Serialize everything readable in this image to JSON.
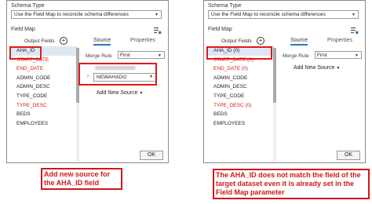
{
  "left": {
    "schema_type_label": "Schema Type",
    "schema_type_value": "Use the Field Map to reconcile schema differences",
    "field_map_label": "Field Map",
    "output_fields_label": "Output Fields",
    "source_tab": "Source",
    "properties_tab": "Properties",
    "fields": [
      {
        "name": "AHA_ID",
        "color": "#222222"
      },
      {
        "name": "START_DATE",
        "color": "#d41c1c"
      },
      {
        "name": "END_DATE",
        "color": "#d41c1c"
      },
      {
        "name": "ADMIN_CODE",
        "color": "#222222"
      },
      {
        "name": "ADMIN_DESC",
        "color": "#222222"
      },
      {
        "name": "TYPE_CODE",
        "color": "#222222"
      },
      {
        "name": "TYPE_DESC",
        "color": "#d41c1c"
      },
      {
        "name": "BEDS",
        "color": "#222222"
      },
      {
        "name": "EMPLOYEES",
        "color": "#222222"
      }
    ],
    "merge_rule_label": "Merge Rule",
    "merge_rule_value": "First",
    "source_value": "NEWAHADI2",
    "add_new_source": "Add New Source",
    "ok_label": "OK",
    "caption": "Add new source for the AHA_ID field"
  },
  "right": {
    "schema_type_label": "Schema Type",
    "schema_type_value": "Use the Field Map to reconcile schema differences",
    "field_map_label": "Field Map",
    "output_fields_label": "Output Fields",
    "source_tab": "Source",
    "properties_tab": "Properties",
    "fields": [
      {
        "name": "AHA_ID (0)",
        "color": "#222222"
      },
      {
        "name": "START_DATE (0)",
        "color": "#d41c1c"
      },
      {
        "name": "END_DATE (0)",
        "color": "#d41c1c"
      },
      {
        "name": "ADMIN_CODE",
        "color": "#222222"
      },
      {
        "name": "ADMIN_DESC",
        "color": "#222222"
      },
      {
        "name": "TYPE_CODE",
        "color": "#222222"
      },
      {
        "name": "TYPE_DESC (0)",
        "color": "#d41c1c"
      },
      {
        "name": "BEDS",
        "color": "#222222"
      },
      {
        "name": "EMPLOYEES",
        "color": "#222222"
      }
    ],
    "merge_rule_label": "Merge Rule",
    "merge_rule_value": "First",
    "add_new_source": "Add New Source",
    "ok_label": "OK",
    "caption": "The AHA_ID does not match the field of the target dataset even it is already set in the Field Map parameter"
  },
  "colors": {
    "highlight_border": "#e01a1a",
    "caption_text": "#d11a1a",
    "required_field": "#d41c1c",
    "tab_accent": "#2a76c6"
  }
}
